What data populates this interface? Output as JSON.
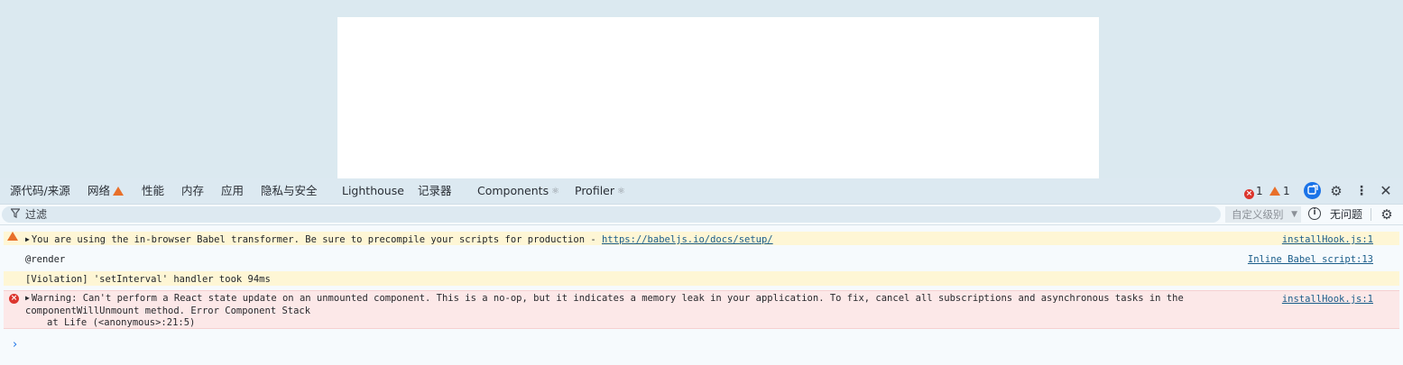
{
  "toolbar": {
    "tabs": [
      {
        "label": "源代码/来源"
      },
      {
        "label": "网络"
      },
      {
        "label": "性能"
      },
      {
        "label": "内存"
      },
      {
        "label": "应用"
      },
      {
        "label": "隐私与安全"
      },
      {
        "label": "Lighthouse"
      },
      {
        "label": "记录器"
      },
      {
        "label": "Components"
      },
      {
        "label": "Profiler"
      }
    ],
    "error_count": "1",
    "warning_count": "1",
    "icons": [
      "error-icon",
      "warning-icon",
      "extension-icon",
      "settings-gear-icon",
      "more-vert-icon",
      "close-icon"
    ]
  },
  "filter": {
    "placeholder": "过滤",
    "levels_label": "自定义级别",
    "issues_label": "无问题"
  },
  "console": {
    "messages": [
      {
        "level": "warning",
        "text_prefix": "You are using the in-browser Babel transformer. Be sure to precompile your scripts for production - ",
        "link": "https://babeljs.io/docs/setup/",
        "source": "installHook.js:1"
      },
      {
        "level": "info",
        "text": "@render",
        "source": "Inline Babel script:13"
      },
      {
        "level": "violation",
        "text": "[Violation] 'setInterval' handler took 94ms"
      },
      {
        "level": "error",
        "text": "Warning: Can't perform a React state update on an unmounted component. This is a no-op, but it indicates a memory leak in your application. To fix, cancel all subscriptions and asynchronous tasks in the componentWillUnmount method. Error Component Stack",
        "stack": "at Life (<anonymous>:21:5)",
        "source": "installHook.js:1"
      }
    ],
    "prompt_symbol": "›"
  },
  "colors": {
    "accent": "#1a73e8",
    "error": "#dc362e",
    "warning": "#e8702a",
    "warning_bg": "#fef6d5",
    "error_bg": "#fce8e8"
  }
}
